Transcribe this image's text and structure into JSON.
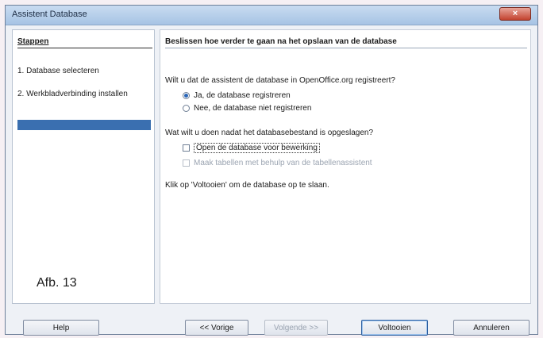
{
  "window": {
    "title": "Assistent Database",
    "close_label": "×"
  },
  "sidebar": {
    "header": "Stappen",
    "steps": [
      "1. Database selecteren",
      "2. Werkbladverbinding installen"
    ],
    "figure_caption": "Afb. 13"
  },
  "main": {
    "title": "Beslissen hoe verder te gaan na het opslaan van de database",
    "question_register": "Wilt u dat de assistent de database in OpenOffice.org registreert?",
    "option_register_yes": "Ja, de database registreren",
    "option_register_no": "Nee, de database niet registreren",
    "question_after_save": "Wat wilt u doen nadat het databasebestand is opgeslagen?",
    "option_open_for_edit": "Open de database voor bewerking",
    "option_create_tables": "Maak tabellen met behulp van de tabellenassistent",
    "finish_note": "Klik op 'Voltooien' om de database op te slaan.",
    "register_selected": "yes",
    "open_for_edit_checked": false,
    "create_tables_enabled": false
  },
  "buttons": {
    "help": "Help",
    "prev": "<< Vorige",
    "next": "Volgende >>",
    "finish": "Voltooien",
    "cancel": "Annuleren"
  }
}
